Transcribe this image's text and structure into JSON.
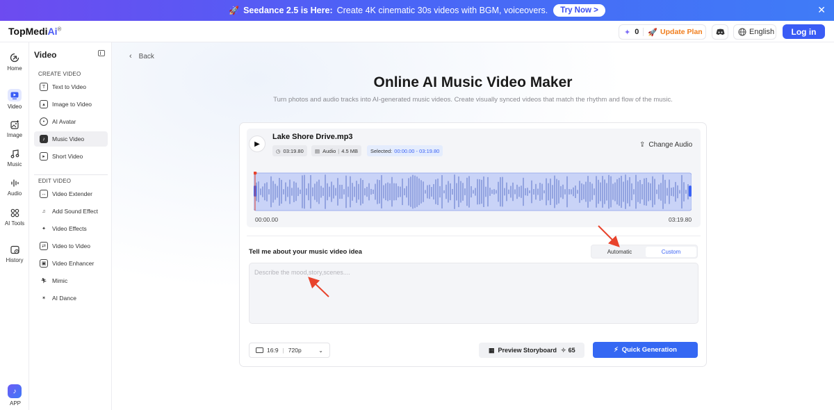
{
  "banner": {
    "rocket_icon": "rocket-icon",
    "title": "Seedance 2.5 is Here:",
    "text": "Create 4K cinematic 30s videos with BGM, voiceovers.",
    "cta": "Try Now >",
    "close": "✕"
  },
  "header": {
    "logo_main": "TopMedi",
    "logo_ai": "Ai",
    "logo_reg": "®",
    "credits": "0",
    "update_plan": "Update Plan",
    "language": "English",
    "login": "Log in"
  },
  "rail": {
    "items": [
      {
        "label": "Home",
        "icon": "home-icon"
      },
      {
        "label": "Video",
        "icon": "video-icon",
        "active": true
      },
      {
        "label": "Image",
        "icon": "image-icon"
      },
      {
        "label": "Music",
        "icon": "music-icon"
      },
      {
        "label": "Audio",
        "icon": "audio-icon"
      },
      {
        "label": "AI Tools",
        "icon": "ai-tools-icon"
      },
      {
        "label": "History",
        "icon": "history-icon"
      }
    ],
    "app_label": "APP"
  },
  "sidebar": {
    "title": "Video",
    "create_heading": "CREATE VIDEO",
    "create_items": [
      "Text to Video",
      "Image to Video",
      "AI Avatar",
      "Music Video",
      "Short Video"
    ],
    "edit_heading": "EDIT VIDEO",
    "edit_items": [
      "Video Extender",
      "Add Sound Effect",
      "Video Effects",
      "Video to Video",
      "Video Enhancer",
      "Mimic",
      "AI Dance"
    ]
  },
  "main": {
    "back": "Back",
    "title": "Online AI Music Video Maker",
    "subtitle": "Turn photos and audio tracks into AI-generated music videos. Create visually synced videos that match the rhythm and flow of the music.",
    "audio": {
      "file_name": "Lake Shore Drive.mp3",
      "duration": "03:19.80",
      "type": "Audio",
      "size": "4.5 MB",
      "selected_label": "Selected:",
      "selected_range": "00:00.00 - 03:19.80",
      "change_audio": "Change Audio",
      "time_start": "00:00.00",
      "time_end": "03:19.80"
    },
    "idea_label": "Tell me about your music video idea",
    "mode": {
      "automatic": "Automatic",
      "custom": "Custom",
      "selected": "Custom"
    },
    "prompt_placeholder": "Describe the mood,story,scenes....",
    "prompt_value": "",
    "ratio": "16:9",
    "resolution": "720p",
    "preview_label": "Preview Storyboard",
    "preview_cost": "65",
    "quick_label": "Quick Generation"
  },
  "colors": {
    "accent": "#3568f3",
    "waveform": "#7c8fd6",
    "waveform_bg": "#c9d3f7",
    "annotation_arrow": "#e8432c"
  }
}
